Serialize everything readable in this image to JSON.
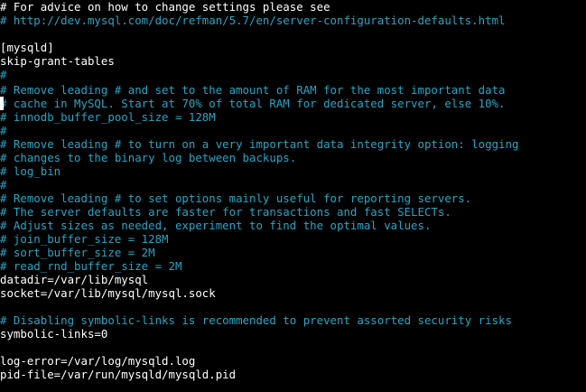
{
  "colors": {
    "background": "#000000",
    "comment": "#2aa4c4",
    "text": "#ffffff"
  },
  "editor": {
    "lines": [
      "# For advice on how to change settings please see",
      "# http://dev.mysql.com/doc/refman/5.7/en/server-configuration-defaults.html",
      "",
      "[mysqld]",
      "skip-grant-tables",
      "#",
      "# Remove leading # and set to the amount of RAM for the most important data",
      "# cache in MySQL. Start at 70% of total RAM for dedicated server, else 10%.",
      "# innodb_buffer_pool_size = 128M",
      "#",
      "# Remove leading # to turn on a very important data integrity option: logging",
      "# changes to the binary log between backups.",
      "# log_bin",
      "#",
      "# Remove leading # to set options mainly useful for reporting servers.",
      "# The server defaults are faster for transactions and fast SELECTs.",
      "# Adjust sizes as needed, experiment to find the optimal values.",
      "# join_buffer_size = 128M",
      "# sort_buffer_size = 2M",
      "# read_rnd_buffer_size = 2M",
      "datadir=/var/lib/mysql",
      "socket=/var/lib/mysql/mysql.sock",
      "",
      "# Disabling symbolic-links is recommended to prevent assorted security risks",
      "symbolic-links=0",
      "",
      "log-error=/var/log/mysqld.log",
      "pid-file=/var/run/mysqld/mysqld.pid"
    ]
  }
}
